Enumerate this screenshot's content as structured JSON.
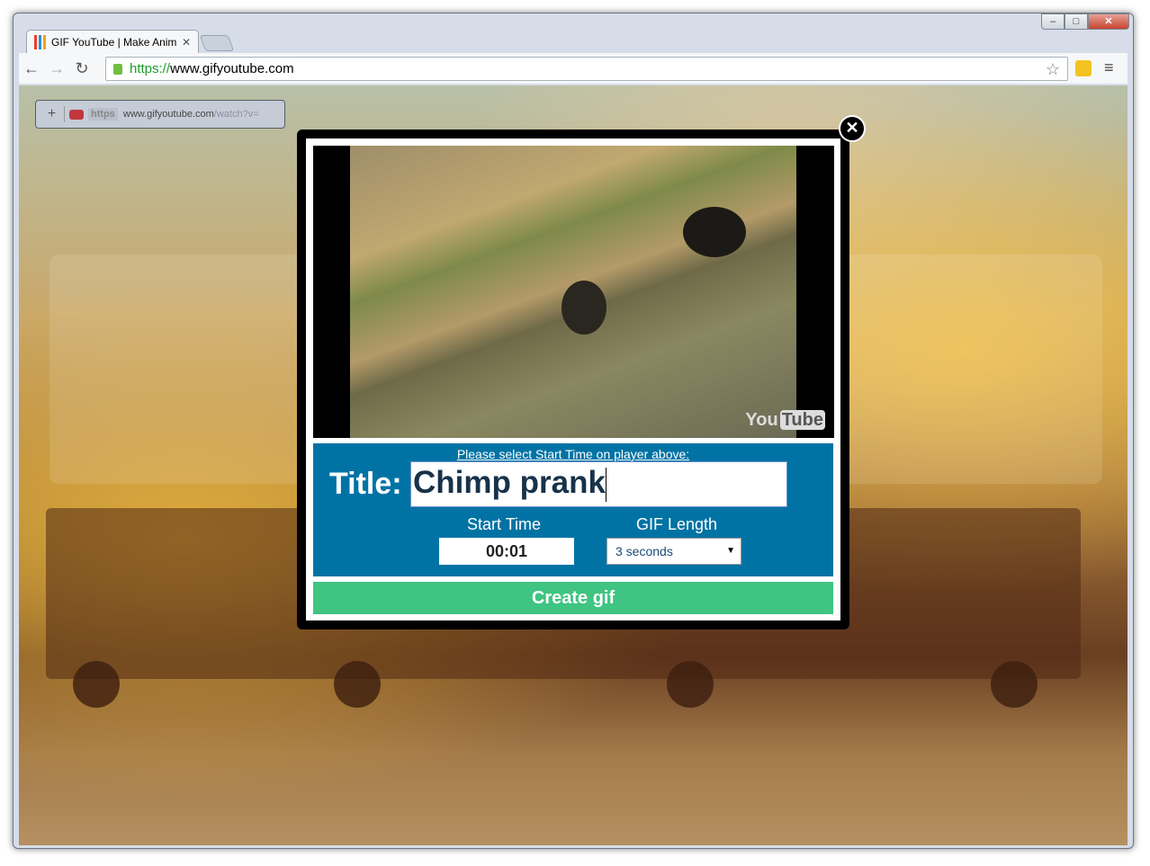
{
  "browser": {
    "tab_title": "GIF YouTube | Make Anim",
    "url_scheme": "https://",
    "url_host": "www.gifyoutube.com"
  },
  "page": {
    "mini_bar": {
      "scheme": "https",
      "url_host": "www.gifyoutube.com",
      "url_path": "/watch?v="
    },
    "modal": {
      "video": {
        "logo_text": "You",
        "logo_tube": "Tube"
      },
      "hint": "Please select Start Time on player above:",
      "title_label": "Title:",
      "title_value": "Chimp prank",
      "start_time_label": "Start Time",
      "start_time_value": "00:01",
      "gif_length_label": "GIF Length",
      "gif_length_value": "3 seconds",
      "create_button": "Create gif"
    }
  },
  "colors": {
    "form_bg": "#0073a4",
    "create_button": "#3fc482"
  }
}
